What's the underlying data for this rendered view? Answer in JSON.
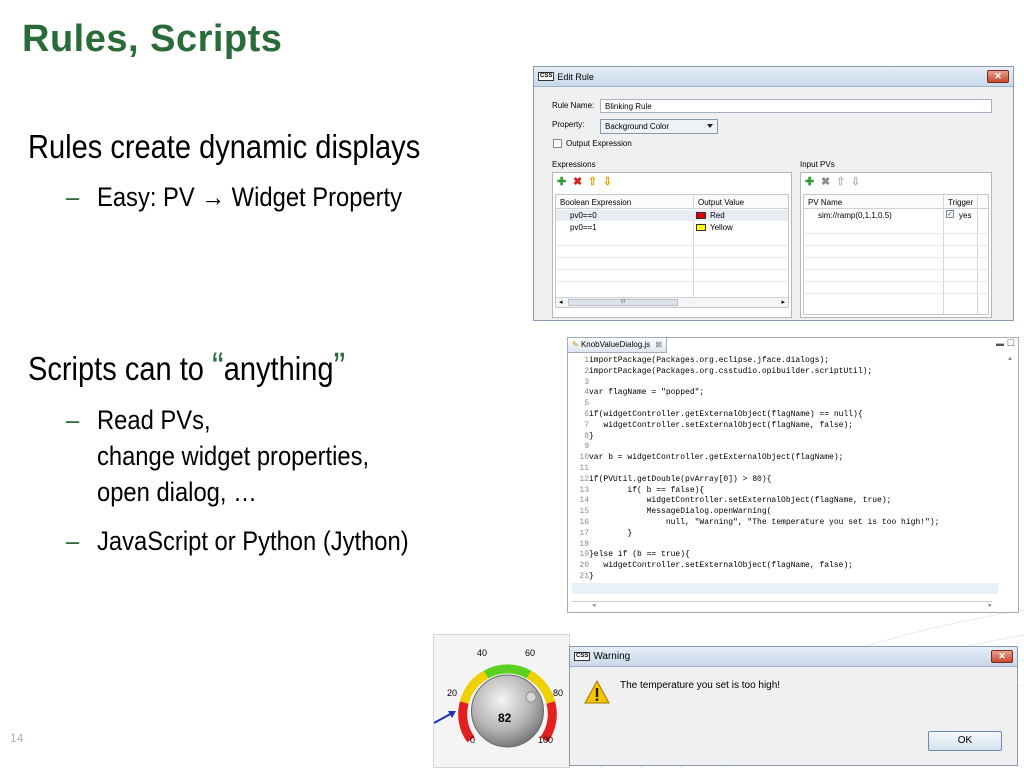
{
  "slide": {
    "title": "Rules, Scripts",
    "bullet1": "Rules create dynamic displays",
    "bullet1_sub": "Easy: PV → Widget Property",
    "bullet2_pre": "Scripts can to ",
    "bullet2_open_quote": "“",
    "bullet2_word": "anything",
    "bullet2_close_quote": "”",
    "bullet2_sub1_line1": "Read PVs,",
    "bullet2_sub1_line2": "change widget properties,",
    "bullet2_sub1_line3": "open dialog, …",
    "bullet2_sub2": "JavaScript or Python (Jython)",
    "dash": "–",
    "page_number": "14",
    "title_color": "#2a6b3a"
  },
  "edit_rule": {
    "logo": "CSS",
    "title": "Edit Rule",
    "close": "✕",
    "rule_name_label": "Rule Name:",
    "rule_name_value": "Blinking Rule",
    "property_label": "Property:",
    "property_value": "Background Color",
    "output_expression_label": "Output Expression",
    "expressions_label": "Expressions",
    "input_pvs_label": "Input PVs",
    "expr_columns": [
      "Boolean Expression",
      "Output Value"
    ],
    "expr_rows": [
      {
        "expr": "pv0==0",
        "value": "Red",
        "color": "#e00000"
      },
      {
        "expr": "pv0==1",
        "value": "Yellow",
        "color": "#ffff00"
      }
    ],
    "pv_columns": [
      "PV Name",
      "Trigger"
    ],
    "pv_rows": [
      {
        "name": "sim://ramp(0,1,1,0.5)",
        "trigger": "yes"
      }
    ],
    "icons": [
      "add-icon",
      "delete-icon",
      "move-up-icon",
      "move-down-icon"
    ],
    "scroll_thumb": "III"
  },
  "script_editor": {
    "tab_label": "KnobValueDialog.js",
    "tab_close": "⊠",
    "lines": [
      {
        "n": "1",
        "code": "importPackage(Packages.org.eclipse.jface.dialogs);"
      },
      {
        "n": "2",
        "code": "importPackage(Packages.org.csstudio.opibuilder.scriptUtil);"
      },
      {
        "n": "3",
        "code": ""
      },
      {
        "n": "4",
        "code": "var flagName = \"popped\";"
      },
      {
        "n": "5",
        "code": ""
      },
      {
        "n": "6",
        "code": "if(widgetController.getExternalObject(flagName) == null){"
      },
      {
        "n": "7",
        "code": "   widgetController.setExternalObject(flagName, false);"
      },
      {
        "n": "8",
        "code": "}"
      },
      {
        "n": "9",
        "code": ""
      },
      {
        "n": "10",
        "code": "var b = widgetController.getExternalObject(flagName);"
      },
      {
        "n": "11",
        "code": ""
      },
      {
        "n": "12",
        "code": "if(PVUtil.getDouble(pvArray[0]) > 80){"
      },
      {
        "n": "13",
        "code": "        if( b == false){"
      },
      {
        "n": "14",
        "code": "            widgetController.setExternalObject(flagName, true);"
      },
      {
        "n": "15",
        "code": "            MessageDialog.openWarning("
      },
      {
        "n": "16",
        "code": "                null, \"Warning\", \"The temperature you set is too high!\");"
      },
      {
        "n": "17",
        "code": "        }"
      },
      {
        "n": "18",
        "code": ""
      },
      {
        "n": "19",
        "code": "}else if (b == true){"
      },
      {
        "n": "20",
        "code": "   widgetController.setExternalObject(flagName, false);"
      },
      {
        "n": "21",
        "code": "}"
      }
    ]
  },
  "gauge": {
    "value": "82",
    "ticks": [
      {
        "label": "0"
      },
      {
        "label": "20"
      },
      {
        "label": "40"
      },
      {
        "label": "60"
      },
      {
        "label": "80"
      },
      {
        "label": "100"
      }
    ]
  },
  "warning": {
    "logo": "CSS",
    "title": "Warning",
    "close": "✕",
    "message": "The temperature you set is too high!",
    "ok_label": "OK",
    "icon": "warning-icon"
  }
}
